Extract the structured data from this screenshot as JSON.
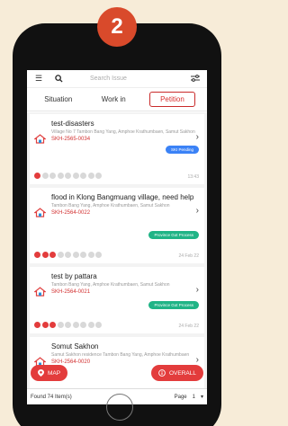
{
  "step_number": "2",
  "search": {
    "placeholder": "Search Issue"
  },
  "tabs": [
    {
      "label": "Situation"
    },
    {
      "label": "Work in"
    },
    {
      "label": "Petition"
    }
  ],
  "cards": [
    {
      "title": "test-disasters",
      "address": "Village No 7 Tambon Bang Yang, Amphoe Krathumbaen, Samut Sakhon",
      "code": "SKH-2565-0034",
      "status": "SKI Pending",
      "status_color": "#3b82f6",
      "date": "13:43"
    },
    {
      "title": "flood in Klong Bangmuang village, need help",
      "address": "Tambon Bang Yang, Amphoe Krathumbaen, Samut Sakhon",
      "code": "SKH-2564-0022",
      "status": "Province Got Process",
      "status_color": "#20b486",
      "date": "24 Feb 22"
    },
    {
      "title": "test by pattara",
      "address": "Tambon Bang Yang, Amphoe Krathumbaen, Samut Sakhon",
      "code": "SKH-2564-0021",
      "status": "Province Got Process",
      "status_color": "#20b486",
      "date": "24 Feb 22"
    },
    {
      "title": "Somut Sakhon",
      "address": "Samut Sakhon residence Tambon Bang Yang, Amphoe Krathumbaen",
      "code": "SKH-2564-0020",
      "status": "",
      "status_color": "#20b486",
      "date": ""
    }
  ],
  "buttons": {
    "map": "MAP",
    "overall": "OVERALL"
  },
  "footer": {
    "found": "Found 74 Item(s)",
    "page_label": "Page",
    "page_value": "1"
  }
}
